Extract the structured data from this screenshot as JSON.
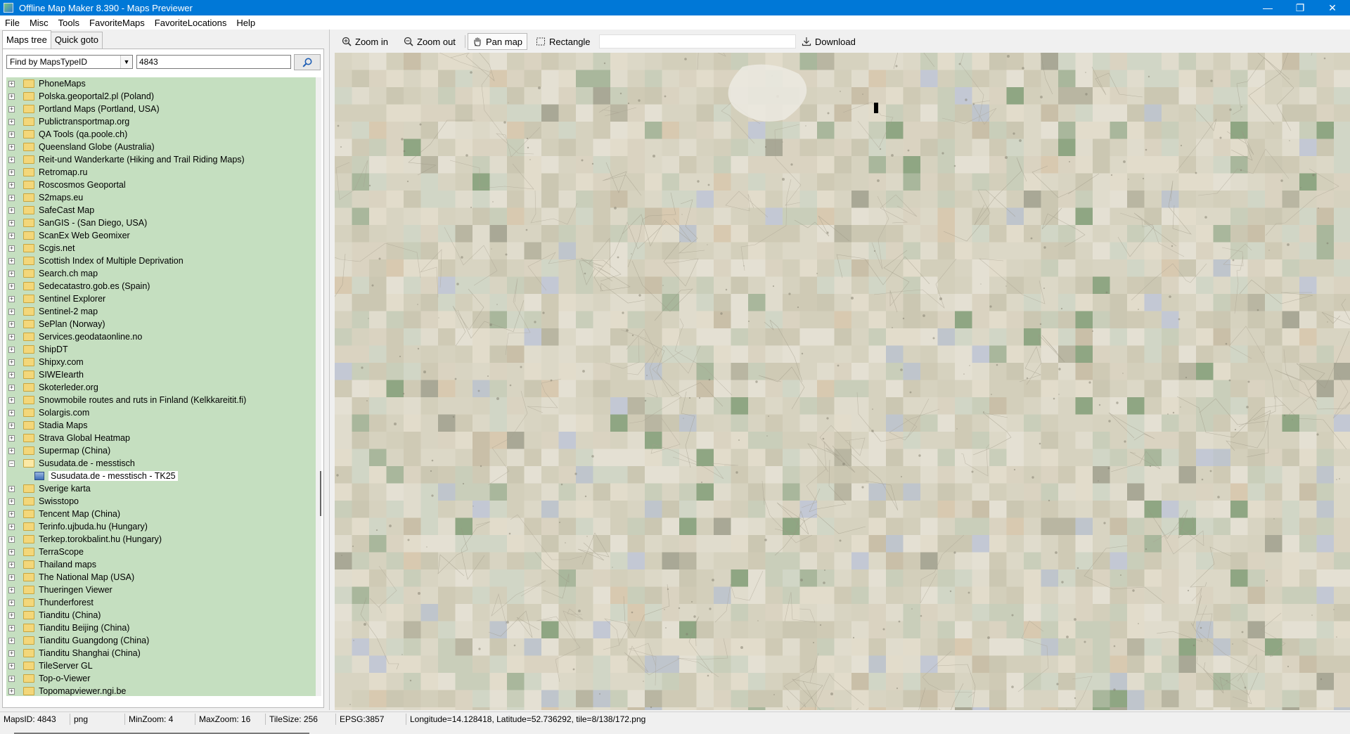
{
  "window": {
    "title": "Offline Map Maker 8.390 - Maps Previewer",
    "controls": [
      "—",
      "❐",
      "✕"
    ]
  },
  "menu": [
    "File",
    "Misc",
    "Tools",
    "FavoriteMaps",
    "FavoriteLocations",
    "Help"
  ],
  "left_panel": {
    "tabs": [
      "Maps tree",
      "Quick goto"
    ],
    "active_tab": "Maps tree",
    "finder": {
      "selected": "Find by MapsTypeID",
      "query": "4843"
    },
    "tree": [
      {
        "label": "PhoneMaps"
      },
      {
        "label": "Polska.geoportal2.pl (Poland)"
      },
      {
        "label": "Portland Maps (Portland, USA)"
      },
      {
        "label": "Publictransportmap.org"
      },
      {
        "label": "QA Tools (qa.poole.ch)"
      },
      {
        "label": "Queensland Globe (Australia)"
      },
      {
        "label": "Reit-und Wanderkarte (Hiking and Trail Riding Maps)"
      },
      {
        "label": "Retromap.ru"
      },
      {
        "label": "Roscosmos Geoportal"
      },
      {
        "label": "S2maps.eu"
      },
      {
        "label": "SafeCast Map"
      },
      {
        "label": "SanGIS - (San Diego, USA)"
      },
      {
        "label": "ScanEx Web Geomixer"
      },
      {
        "label": "Scgis.net"
      },
      {
        "label": "Scottish Index of Multiple Deprivation"
      },
      {
        "label": "Search.ch map"
      },
      {
        "label": "Sedecatastro.gob.es (Spain)"
      },
      {
        "label": "Sentinel Explorer"
      },
      {
        "label": "Sentinel-2 map"
      },
      {
        "label": "SePlan (Norway)"
      },
      {
        "label": "Services.geodataonline.no"
      },
      {
        "label": "ShipDT"
      },
      {
        "label": "Shipxy.com"
      },
      {
        "label": "SIWEIearth"
      },
      {
        "label": "Skoterleder.org"
      },
      {
        "label": "Snowmobile routes and ruts in Finland (Kelkkareitit.fi)"
      },
      {
        "label": "Solargis.com"
      },
      {
        "label": "Stadia Maps"
      },
      {
        "label": "Strava Global Heatmap"
      },
      {
        "label": "Supermap (China)"
      },
      {
        "label": "Susudata.de - messtisch",
        "expanded": true,
        "children": [
          "Susudata.de - messtisch - TK25"
        ]
      },
      {
        "label": "Sverige karta"
      },
      {
        "label": "Swisstopo"
      },
      {
        "label": "Tencent Map (China)"
      },
      {
        "label": "Terinfo.ujbuda.hu (Hungary)"
      },
      {
        "label": "Terkep.torokbalint.hu (Hungary)"
      },
      {
        "label": "TerraScope"
      },
      {
        "label": "Thailand maps"
      },
      {
        "label": "The National Map (USA)"
      },
      {
        "label": "Thueringen Viewer"
      },
      {
        "label": "Thunderforest"
      },
      {
        "label": "Tianditu (China)"
      },
      {
        "label": "Tianditu Beijing (China)"
      },
      {
        "label": "Tianditu Guangdong (China)"
      },
      {
        "label": "Tianditu Shanghai (China)"
      },
      {
        "label": "TileServer GL"
      },
      {
        "label": "Top-o-Viewer"
      },
      {
        "label": "Topomapviewer.ngi.be"
      }
    ]
  },
  "toolbar": {
    "zoom_in": "Zoom in",
    "zoom_out": "Zoom out",
    "pan_map": "Pan map",
    "rectangle": "Rectangle",
    "download": "Download"
  },
  "status": {
    "maps_id": "MapsID: 4843",
    "format": "png",
    "min_zoom": "MinZoom: 4",
    "max_zoom": "MaxZoom: 16",
    "tile_size": "TileSize: 256",
    "epsg": "EPSG:3857",
    "position": "Longitude=14.128418, Latitude=52.736292, tile=8/138/172.png"
  }
}
